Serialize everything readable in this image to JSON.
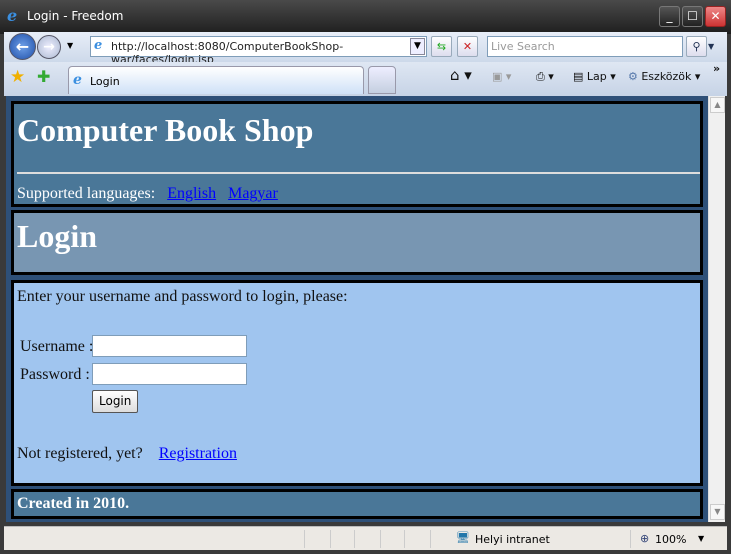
{
  "window": {
    "title": "Login - Freedom"
  },
  "nav": {
    "url": "http://localhost:8080/ComputerBookShop-war/faces/login.jsp",
    "search_placeholder": "Live Search"
  },
  "tabs": [
    {
      "label": "Login"
    }
  ],
  "toolbar": {
    "page_label": "Lap",
    "tools_label": "Eszközök"
  },
  "page": {
    "site_title": "Computer Book Shop",
    "languages_label": "Supported languages:",
    "languages": [
      "English",
      "Magyar"
    ],
    "heading": "Login",
    "intro": "Enter your username and password to login, please:",
    "username_label": "Username :",
    "password_label": "Password :",
    "username_value": "",
    "password_value": "",
    "login_button": "Login",
    "not_registered": "Not registered, yet?",
    "registration_link": "Registration",
    "footer": "Created in 2010."
  },
  "status": {
    "zone": "Helyi intranet",
    "zoom": "100%"
  },
  "colors": {
    "header": "#4a7798",
    "title_panel": "#7896b2",
    "main_panel": "#a0c5ef",
    "page_bg": "#2e5078",
    "link": "#0000ff"
  }
}
